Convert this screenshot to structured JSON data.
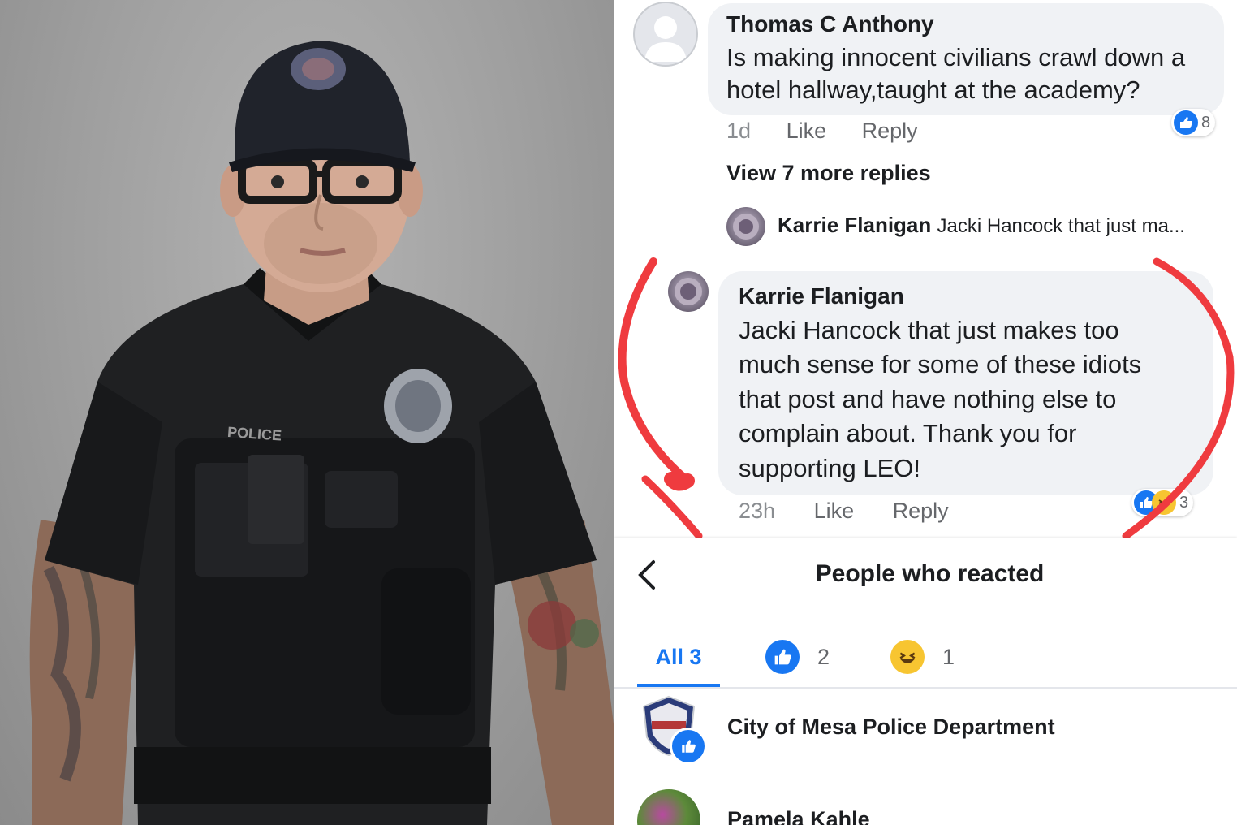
{
  "comment1": {
    "author": "Thomas C Anthony",
    "text_line1": "Is making innocent civilians crawl down a",
    "text_line2": "hotel hallway,taught at the academy?",
    "time": "1d",
    "like_label": "Like",
    "reply_label": "Reply",
    "reaction_count": "8"
  },
  "view_more_replies": "View 7 more replies",
  "reply_preview": {
    "author": "Karrie Flanigan",
    "text": "Jacki Hancock that just ma..."
  },
  "comment2": {
    "author": "Karrie Flanigan",
    "lines": [
      "Jacki Hancock that just makes too",
      "much sense for some of these idiots",
      "that post and have nothing else to",
      "complain about. Thank you for",
      "supporting LEO!"
    ],
    "time": "23h",
    "like_label": "Like",
    "reply_label": "Reply",
    "reaction_count": "3"
  },
  "reactions_dialog": {
    "title": "People who reacted",
    "tabs": [
      {
        "label": "All 3"
      },
      {
        "icon": "like-icon",
        "count": "2"
      },
      {
        "icon": "haha-icon",
        "count": "1"
      }
    ],
    "people": [
      {
        "name": "City of Mesa Police Department"
      },
      {
        "name": "Pamela Kahle"
      }
    ]
  },
  "photo": {
    "shirt_text": "POLICE"
  },
  "colors": {
    "facebook_blue": "#1877f2",
    "bubble_gray": "#f0f2f5",
    "annotation_red": "#ef3b3f",
    "haha_yellow": "#f7c531"
  }
}
